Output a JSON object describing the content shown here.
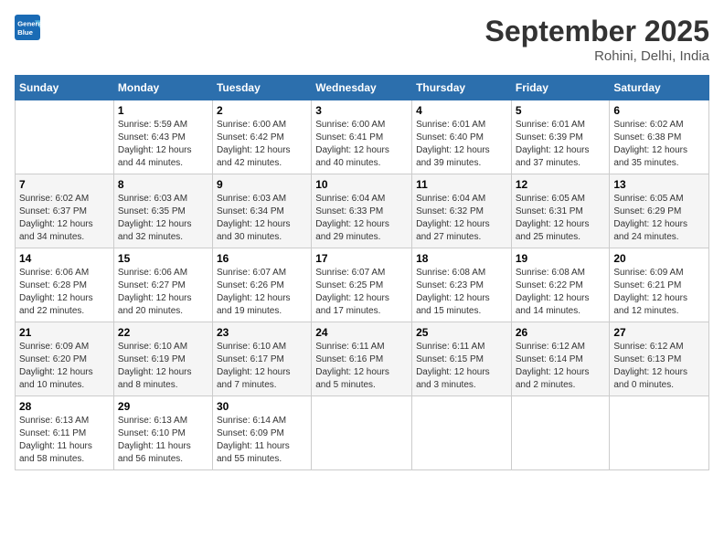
{
  "logo": {
    "line1": "General",
    "line2": "Blue"
  },
  "title": "September 2025",
  "location": "Rohini, Delhi, India",
  "weekdays": [
    "Sunday",
    "Monday",
    "Tuesday",
    "Wednesday",
    "Thursday",
    "Friday",
    "Saturday"
  ],
  "weeks": [
    [
      {
        "day": "",
        "info": ""
      },
      {
        "day": "1",
        "info": "Sunrise: 5:59 AM\nSunset: 6:43 PM\nDaylight: 12 hours\nand 44 minutes."
      },
      {
        "day": "2",
        "info": "Sunrise: 6:00 AM\nSunset: 6:42 PM\nDaylight: 12 hours\nand 42 minutes."
      },
      {
        "day": "3",
        "info": "Sunrise: 6:00 AM\nSunset: 6:41 PM\nDaylight: 12 hours\nand 40 minutes."
      },
      {
        "day": "4",
        "info": "Sunrise: 6:01 AM\nSunset: 6:40 PM\nDaylight: 12 hours\nand 39 minutes."
      },
      {
        "day": "5",
        "info": "Sunrise: 6:01 AM\nSunset: 6:39 PM\nDaylight: 12 hours\nand 37 minutes."
      },
      {
        "day": "6",
        "info": "Sunrise: 6:02 AM\nSunset: 6:38 PM\nDaylight: 12 hours\nand 35 minutes."
      }
    ],
    [
      {
        "day": "7",
        "info": "Sunrise: 6:02 AM\nSunset: 6:37 PM\nDaylight: 12 hours\nand 34 minutes."
      },
      {
        "day": "8",
        "info": "Sunrise: 6:03 AM\nSunset: 6:35 PM\nDaylight: 12 hours\nand 32 minutes."
      },
      {
        "day": "9",
        "info": "Sunrise: 6:03 AM\nSunset: 6:34 PM\nDaylight: 12 hours\nand 30 minutes."
      },
      {
        "day": "10",
        "info": "Sunrise: 6:04 AM\nSunset: 6:33 PM\nDaylight: 12 hours\nand 29 minutes."
      },
      {
        "day": "11",
        "info": "Sunrise: 6:04 AM\nSunset: 6:32 PM\nDaylight: 12 hours\nand 27 minutes."
      },
      {
        "day": "12",
        "info": "Sunrise: 6:05 AM\nSunset: 6:31 PM\nDaylight: 12 hours\nand 25 minutes."
      },
      {
        "day": "13",
        "info": "Sunrise: 6:05 AM\nSunset: 6:29 PM\nDaylight: 12 hours\nand 24 minutes."
      }
    ],
    [
      {
        "day": "14",
        "info": "Sunrise: 6:06 AM\nSunset: 6:28 PM\nDaylight: 12 hours\nand 22 minutes."
      },
      {
        "day": "15",
        "info": "Sunrise: 6:06 AM\nSunset: 6:27 PM\nDaylight: 12 hours\nand 20 minutes."
      },
      {
        "day": "16",
        "info": "Sunrise: 6:07 AM\nSunset: 6:26 PM\nDaylight: 12 hours\nand 19 minutes."
      },
      {
        "day": "17",
        "info": "Sunrise: 6:07 AM\nSunset: 6:25 PM\nDaylight: 12 hours\nand 17 minutes."
      },
      {
        "day": "18",
        "info": "Sunrise: 6:08 AM\nSunset: 6:23 PM\nDaylight: 12 hours\nand 15 minutes."
      },
      {
        "day": "19",
        "info": "Sunrise: 6:08 AM\nSunset: 6:22 PM\nDaylight: 12 hours\nand 14 minutes."
      },
      {
        "day": "20",
        "info": "Sunrise: 6:09 AM\nSunset: 6:21 PM\nDaylight: 12 hours\nand 12 minutes."
      }
    ],
    [
      {
        "day": "21",
        "info": "Sunrise: 6:09 AM\nSunset: 6:20 PM\nDaylight: 12 hours\nand 10 minutes."
      },
      {
        "day": "22",
        "info": "Sunrise: 6:10 AM\nSunset: 6:19 PM\nDaylight: 12 hours\nand 8 minutes."
      },
      {
        "day": "23",
        "info": "Sunrise: 6:10 AM\nSunset: 6:17 PM\nDaylight: 12 hours\nand 7 minutes."
      },
      {
        "day": "24",
        "info": "Sunrise: 6:11 AM\nSunset: 6:16 PM\nDaylight: 12 hours\nand 5 minutes."
      },
      {
        "day": "25",
        "info": "Sunrise: 6:11 AM\nSunset: 6:15 PM\nDaylight: 12 hours\nand 3 minutes."
      },
      {
        "day": "26",
        "info": "Sunrise: 6:12 AM\nSunset: 6:14 PM\nDaylight: 12 hours\nand 2 minutes."
      },
      {
        "day": "27",
        "info": "Sunrise: 6:12 AM\nSunset: 6:13 PM\nDaylight: 12 hours\nand 0 minutes."
      }
    ],
    [
      {
        "day": "28",
        "info": "Sunrise: 6:13 AM\nSunset: 6:11 PM\nDaylight: 11 hours\nand 58 minutes."
      },
      {
        "day": "29",
        "info": "Sunrise: 6:13 AM\nSunset: 6:10 PM\nDaylight: 11 hours\nand 56 minutes."
      },
      {
        "day": "30",
        "info": "Sunrise: 6:14 AM\nSunset: 6:09 PM\nDaylight: 11 hours\nand 55 minutes."
      },
      {
        "day": "",
        "info": ""
      },
      {
        "day": "",
        "info": ""
      },
      {
        "day": "",
        "info": ""
      },
      {
        "day": "",
        "info": ""
      }
    ]
  ]
}
